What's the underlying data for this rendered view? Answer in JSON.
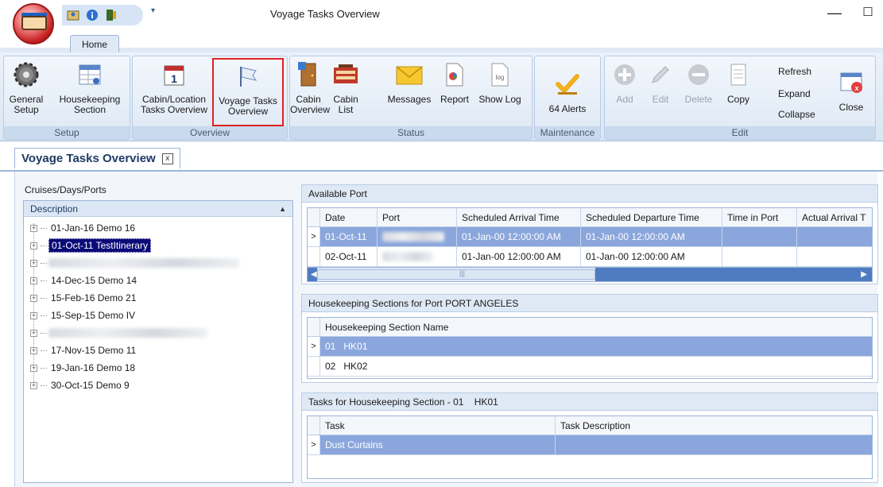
{
  "window": {
    "title": "Voyage Tasks Overview",
    "minimize": "—",
    "maximize": "☐"
  },
  "ribbon": {
    "tab": "Home",
    "groups": {
      "setup": "Setup",
      "overview": "Overview",
      "status": "Status",
      "maintenance": "Maintenance",
      "edit": "Edit"
    },
    "buttons": {
      "general_setup": [
        "General",
        "Setup"
      ],
      "housekeeping_section": [
        "Housekeeping",
        "Section"
      ],
      "cabin_location": [
        "Cabin/Location",
        "Tasks Overview"
      ],
      "voyage_tasks": [
        "Voyage Tasks",
        "Overview"
      ],
      "cabin_overview": [
        "Cabin",
        "Overview"
      ],
      "cabin_list": [
        "Cabin",
        "List"
      ],
      "messages": "Messages",
      "report": "Report",
      "show_log": "Show Log",
      "alerts": "64 Alerts",
      "add": "Add",
      "edit": "Edit",
      "delete": "Delete",
      "copy": "Copy",
      "refresh": "Refresh",
      "expand": "Expand",
      "collapse": "Collapse",
      "close": "Close"
    }
  },
  "doc_tab": {
    "title": "Voyage Tasks Overview",
    "close": "x"
  },
  "left": {
    "title": "Cruises/Days/Ports",
    "column": "Description",
    "sort_icon": "▲",
    "items": [
      {
        "label": "01-Jan-16 Demo 16"
      },
      {
        "label": "01-Oct-11 TestItinerary"
      },
      {
        "label": ""
      },
      {
        "label": "14-Dec-15 Demo 14"
      },
      {
        "label": "15-Feb-16 Demo 21"
      },
      {
        "label": "15-Sep-15 Demo IV"
      },
      {
        "label": ""
      },
      {
        "label": "17-Nov-15 Demo 11"
      },
      {
        "label": "19-Jan-16 Demo 18"
      },
      {
        "label": "30-Oct-15 Demo 9"
      }
    ]
  },
  "available_port": {
    "title": "Available Port",
    "columns": [
      "Date",
      "Port",
      "Scheduled Arrival Time",
      "Scheduled Departure Time",
      "Time in Port",
      "Actual Arrival T"
    ],
    "rows": [
      {
        "date": "01-Oct-11",
        "port": "",
        "arrival": "01-Jan-00 12:00:00 AM",
        "departure": "01-Jan-00 12:00:00 AM",
        "time_in_port": "",
        "actual": ""
      },
      {
        "date": "02-Oct-11",
        "port": "",
        "arrival": "01-Jan-00 12:00:00 AM",
        "departure": "01-Jan-00 12:00:00 AM",
        "time_in_port": "",
        "actual": ""
      }
    ],
    "scroll_thumb": "|||"
  },
  "hk_sections": {
    "title": "Housekeeping Sections for Port PORT ANGELES",
    "column": "Housekeeping Section Name",
    "rows": [
      {
        "num": "01",
        "name": "HK01"
      },
      {
        "num": "02",
        "name": "HK02"
      }
    ]
  },
  "tasks": {
    "title": "Tasks for Housekeeping Section - 01    HK01",
    "columns": [
      "Task",
      "Task Description"
    ],
    "rows": [
      {
        "task": "Dust Curtains",
        "description": ""
      }
    ]
  },
  "row_indicator": ">",
  "colors": {
    "selection_dark": "#0a0a78",
    "selection_grid": "#8aa6dc",
    "highlight_box": "#e02020",
    "ribbon_bg": "#dbe6f4"
  }
}
